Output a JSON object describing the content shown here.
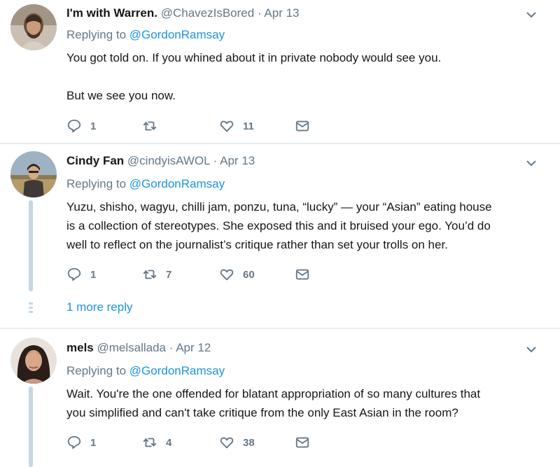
{
  "tweets": [
    {
      "name": "I'm with Warren.",
      "handle": "@ChavezIsBored",
      "sep": "·",
      "date": "Apr 13",
      "replying_label": "Replying to ",
      "replying_to": "@GordonRamsay",
      "lines": [
        "You got told on. If you whined about it in private nobody would see you.",
        "",
        "But we see you now."
      ],
      "reply_count": "1",
      "retweet_count": "",
      "like_count": "11"
    },
    {
      "name": "Cindy Fan",
      "handle": "@cindyisAWOL",
      "sep": "·",
      "date": "Apr 13",
      "replying_label": "Replying to ",
      "replying_to": "@GordonRamsay",
      "lines": [
        "Yuzu, shisho, wagyu, chilli jam, ponzu, tuna, “lucky” — your “Asian” eating house",
        "is a collection of stereotypes. She exposed this and it bruised your ego. You’d do",
        "well to reflect on the journalist’s critique rather than set your trolls on her."
      ],
      "reply_count": "1",
      "retweet_count": "7",
      "like_count": "60"
    },
    {
      "name": "mels",
      "handle": "@melsallada",
      "sep": "·",
      "date": "Apr 12",
      "replying_label": "Replying to ",
      "replying_to": "@GordonRamsay",
      "lines": [
        "Wait. You're the one offended for blatant appropriation of so many cultures that",
        "you simplified and can't take critique from the only East Asian in the room?"
      ],
      "reply_count": "1",
      "retweet_count": "4",
      "like_count": "38"
    }
  ],
  "more_replies": "1 more reply",
  "icons": {
    "reply": "reply-icon",
    "retweet": "retweet-icon",
    "like": "heart-icon",
    "dm": "envelope-icon",
    "caret": "chevron-down-icon"
  },
  "colors": {
    "link": "#1b95e0",
    "muted": "#657786",
    "thread": "#c4d7e3",
    "divider": "#e6ecf0"
  }
}
